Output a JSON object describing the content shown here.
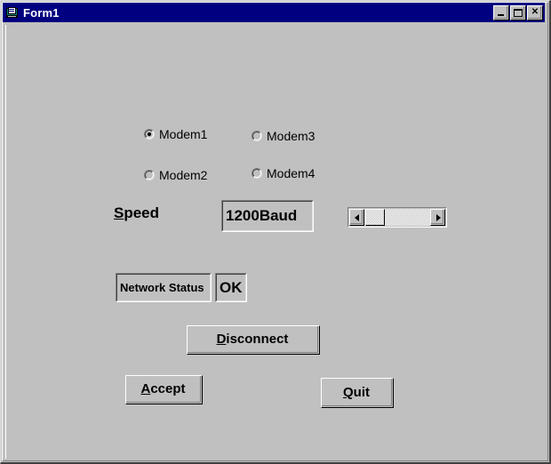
{
  "window": {
    "title": "Form1",
    "icon": "vb-form-icon",
    "titlebar_color": "#000080",
    "face_color": "#c0c0c0",
    "buttons": [
      {
        "name": "minimize",
        "glyph": "_"
      },
      {
        "name": "maximize",
        "glyph": "□"
      },
      {
        "name": "close",
        "glyph": "×"
      }
    ]
  },
  "form": {
    "modems": [
      {
        "label": "Modem1",
        "checked": true
      },
      {
        "label": "Modem2",
        "checked": false
      },
      {
        "label": "Modem3",
        "checked": false
      },
      {
        "label": "Modem4",
        "checked": false
      }
    ],
    "speed": {
      "label_prefix": "S",
      "label_rest": "peed",
      "value": "1200Baud"
    },
    "scrollbar": {
      "left_arrow": "◄",
      "right_arrow": "►",
      "value": 0,
      "min": 0,
      "max": 100
    },
    "status": {
      "caption": "Network Status",
      "value": "OK"
    },
    "buttons": {
      "disconnect": {
        "acc": "D",
        "rest": "isconnect"
      },
      "accept": {
        "acc": "A",
        "rest": "ccept"
      },
      "quit": {
        "acc": "Q",
        "rest": "uit"
      }
    }
  }
}
